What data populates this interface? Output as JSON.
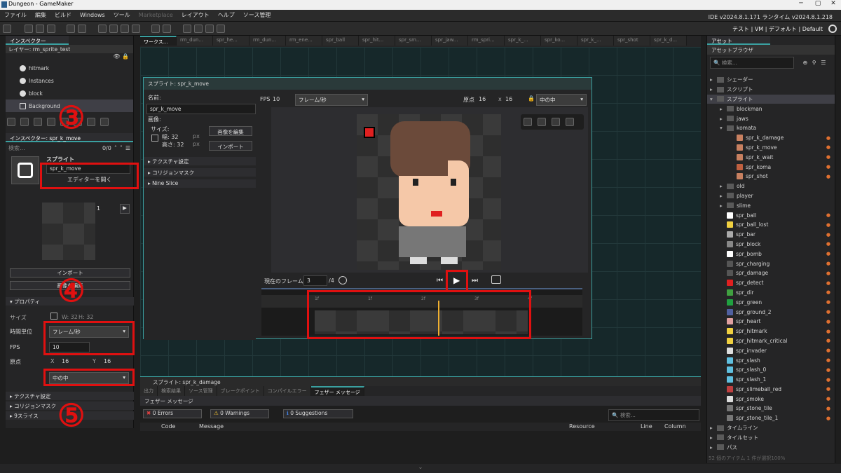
{
  "window": {
    "title": "Dungeon - GameMaker",
    "min": "─",
    "max": "▢",
    "close": "✕"
  },
  "menu": [
    "ファイル",
    "編集",
    "ビルド",
    "Windows",
    "ツール",
    "Marketplace",
    "レイアウト",
    "ヘルプ",
    "ソース管理"
  ],
  "menu_right": "IDE v2024.8.1.171  ランタイム v2024.8.1.218",
  "toolbar_right": "テスト | VM | デフォルト | Default",
  "inspector": {
    "tab": "インスペクター",
    "layer": "レイヤー: rm_sprite_test",
    "layers": [
      "hitmark",
      "Instances",
      "block",
      "Background"
    ],
    "inspector2": "インスペクター: spr_k_move",
    "search": "検索...",
    "count": "0/0",
    "sprite_label": "スプライト",
    "sprite_value": "spr_k_move",
    "open_editor": "エディターを開く",
    "frame": "1",
    "import": "インポート",
    "edit_image": "画像を編集",
    "props": "プロパティ",
    "size_label": "サイズ",
    "size_w": "W: 32",
    "size_h": "H: 32",
    "time_unit_label": "時間単位",
    "time_unit": "フレーム/秒",
    "fps_label": "FPS",
    "fps": "10",
    "origin_label": "原点",
    "x_label": "X",
    "x": "16",
    "y_label": "Y",
    "y": "16",
    "origin_value": "中の中",
    "sections": [
      "テクスチャ設定",
      "コリジョンマスク",
      "9スライス"
    ]
  },
  "annotations": {
    "n3": "③",
    "n4": "④",
    "n5": "⑤"
  },
  "workspace_tabs": [
    "ワークス...",
    "rm_dun...",
    "spr_he...",
    "rm_dun...",
    "rm_ene...",
    "spr_ball",
    "spr_hit...",
    "spr_sm...",
    "spr_jaw...",
    "rm_spri...",
    "spr_k_...",
    "spr_ko...",
    "spr_k_...",
    "spr_shot",
    "spr_k_d..."
  ],
  "sprite_editor": {
    "title": "スプライト: spr_k_move",
    "name_label": "名前:",
    "name": "spr_k_move",
    "image_label": "画像:",
    "size_label": "サイズ:",
    "w_label": "幅: 32",
    "h_label": "高さ: 32",
    "px1": "px",
    "px2": "px",
    "edit_btn": "画像を編集",
    "import_btn": "インポート",
    "sections": [
      "テクスチャ設定",
      "コリジョンマスク",
      "Nine Slice"
    ],
    "fps_label": "FPS",
    "fps": "10",
    "unit": "フレーム/秒",
    "origin_label": "原点",
    "ox": "16",
    "x_sep": "x",
    "oy": "16",
    "origin_value": "中の中",
    "current_frame_label": "現在のフレーム:",
    "current_frame": "3",
    "total_frames": "/4",
    "timeline_marks": [
      "1f",
      "1f",
      "2f",
      "3f",
      "4f"
    ]
  },
  "bottom": {
    "title": "スプライト: spr_k_damage",
    "tabs": [
      "出力",
      "検索結果",
      "ソース管理",
      "ブレークポイント",
      "コンパイルエラー",
      "フェザー メッセージ"
    ],
    "header": "フェザー メッセージ",
    "errors": "0 Errors",
    "warnings": "0 Warnings",
    "suggestions": "0 Suggestions",
    "search": "検索...",
    "cols": [
      "Code",
      "Message",
      "Resource",
      "Line",
      "Column"
    ]
  },
  "assets": {
    "tab": "アセット",
    "header": "アセットブラウザ",
    "search": "検索...",
    "items": [
      {
        "label": "シェーダー",
        "level": 0,
        "type": "folder"
      },
      {
        "label": "スクリプト",
        "level": 0,
        "type": "folder"
      },
      {
        "label": "スプライト",
        "level": 0,
        "type": "folder",
        "open": true
      },
      {
        "label": "blockman",
        "level": 1,
        "type": "folder"
      },
      {
        "label": "jaws",
        "level": 1,
        "type": "folder"
      },
      {
        "label": "komata",
        "level": 1,
        "type": "folder",
        "open": true
      },
      {
        "label": "spr_k_damage",
        "level": 2,
        "type": "sprite",
        "color": "#c88060"
      },
      {
        "label": "spr_k_move",
        "level": 2,
        "type": "sprite",
        "color": "#c88060"
      },
      {
        "label": "spr_k_wait",
        "level": 2,
        "type": "sprite",
        "color": "#c88060"
      },
      {
        "label": "spr_koma",
        "level": 2,
        "type": "sprite",
        "color": "#c06040"
      },
      {
        "label": "spr_shot",
        "level": 2,
        "type": "sprite",
        "color": "#c88060"
      },
      {
        "label": "old",
        "level": 1,
        "type": "folder"
      },
      {
        "label": "player",
        "level": 1,
        "type": "folder"
      },
      {
        "label": "slime",
        "level": 1,
        "type": "folder"
      },
      {
        "label": "spr_ball",
        "level": 1,
        "type": "sprite",
        "color": "#ffffff"
      },
      {
        "label": "spr_ball_lost",
        "level": 1,
        "type": "sprite",
        "color": "#f0d040"
      },
      {
        "label": "spr_bar",
        "level": 1,
        "type": "sprite",
        "color": "#aaaaaa"
      },
      {
        "label": "spr_block",
        "level": 1,
        "type": "sprite",
        "color": "#888888"
      },
      {
        "label": "spr_bomb",
        "level": 1,
        "type": "sprite",
        "color": "#ffffff"
      },
      {
        "label": "spr_charging",
        "level": 1,
        "type": "sprite",
        "color": "#555555"
      },
      {
        "label": "spr_damage",
        "level": 1,
        "type": "sprite",
        "color": "#555555"
      },
      {
        "label": "spr_detect",
        "level": 1,
        "type": "sprite",
        "color": "#e02020"
      },
      {
        "label": "spr_dir",
        "level": 1,
        "type": "sprite",
        "color": "#40a040"
      },
      {
        "label": "spr_green",
        "level": 1,
        "type": "sprite",
        "color": "#20a040"
      },
      {
        "label": "spr_ground_2",
        "level": 1,
        "type": "sprite",
        "color": "#5060a0"
      },
      {
        "label": "spr_heart",
        "level": 1,
        "type": "sprite",
        "color": "#e0a0a0"
      },
      {
        "label": "spr_hitmark",
        "level": 1,
        "type": "sprite",
        "color": "#f0d040"
      },
      {
        "label": "spr_hitmark_critical",
        "level": 1,
        "type": "sprite",
        "color": "#f0d040"
      },
      {
        "label": "spr_invader",
        "level": 1,
        "type": "sprite",
        "color": "#dddddd"
      },
      {
        "label": "spr_slash",
        "level": 1,
        "type": "sprite",
        "color": "#60c0e0"
      },
      {
        "label": "spr_slash_0",
        "level": 1,
        "type": "sprite",
        "color": "#60c0e0"
      },
      {
        "label": "spr_slash_1",
        "level": 1,
        "type": "sprite",
        "color": "#60c0e0"
      },
      {
        "label": "spr_slimeball_red",
        "level": 1,
        "type": "sprite",
        "color": "#c04040"
      },
      {
        "label": "spr_smoke",
        "level": 1,
        "type": "sprite",
        "color": "#dddddd"
      },
      {
        "label": "spr_stone_tile",
        "level": 1,
        "type": "sprite",
        "color": "#777777"
      },
      {
        "label": "spr_stone_tile_1",
        "level": 1,
        "type": "sprite",
        "color": "#777777"
      },
      {
        "label": "タイムライン",
        "level": 0,
        "type": "folder"
      },
      {
        "label": "タイルセット",
        "level": 0,
        "type": "folder"
      },
      {
        "label": "パス",
        "level": 0,
        "type": "folder"
      }
    ],
    "status": "52 個のアイテム  1 件が選択100%"
  },
  "colors": {
    "accent": "#3aa0a0",
    "highlight": "#e01010"
  }
}
